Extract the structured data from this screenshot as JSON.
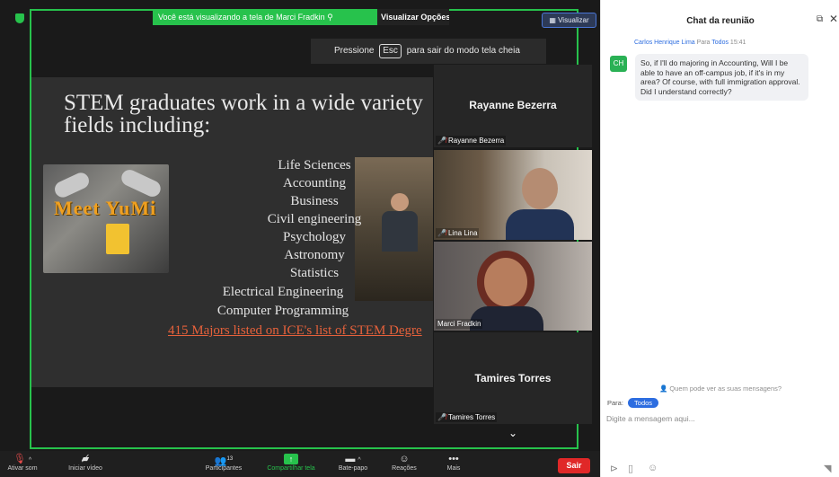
{
  "share": {
    "banner_text": "Você está visualizando a tela de  Marci Fradkin",
    "view_options": "Visualizar Opções",
    "view_button": "Visualizar",
    "esc_before": "Pressione",
    "esc_key": "Esc",
    "esc_after": "para sair do modo tela cheia"
  },
  "slide": {
    "title_line1": "STEM graduates work in a wide variety",
    "title_line2": "fields including:",
    "image_text": "Meet YuMi",
    "majors": [
      "Life Sciences",
      "Accounting",
      "Business",
      "Civil engineering",
      "Psychology",
      "Astronomy",
      "Statistics",
      "Electrical Engineering",
      "Computer Programming"
    ],
    "link": "415 Majors listed on ICE's list of STEM Degre"
  },
  "participants": [
    {
      "name": "Rayanne Bezerra",
      "label": "Rayanne Bezerra",
      "muted": true
    },
    {
      "name": "Lina Lina",
      "label": "Lina Lina",
      "muted": true
    },
    {
      "name": "Marci Fradkin",
      "label": "Marci Fradkin",
      "muted": false
    },
    {
      "name": "Tamires Torres",
      "label": "Tamires Torres",
      "muted": true
    }
  ],
  "toolbar": {
    "audio": "Ativar som",
    "video": "Iniciar vídeo",
    "participants": "Participantes",
    "participants_count": "13",
    "share": "Compartilhar tela",
    "chat": "Bate-papo",
    "reactions": "Reações",
    "more": "Mais",
    "leave": "Sair"
  },
  "chat": {
    "title": "Chat da reunião",
    "sender": "Carlos Henrique Lima",
    "to_label": "Para",
    "to_target": "Todos",
    "time": "15:41",
    "avatar": "CH",
    "message": "So, if I'll do majoring in Accounting, Will I be able to have an off-campus job, if it's in my area? Of course, with full immigration approval. Did I understand correctly?",
    "privacy": "Quem pode ver as suas mensagens?",
    "recipient_label": "Para:",
    "recipient": "Todos",
    "placeholder": "Digite a mensagem aqui..."
  }
}
